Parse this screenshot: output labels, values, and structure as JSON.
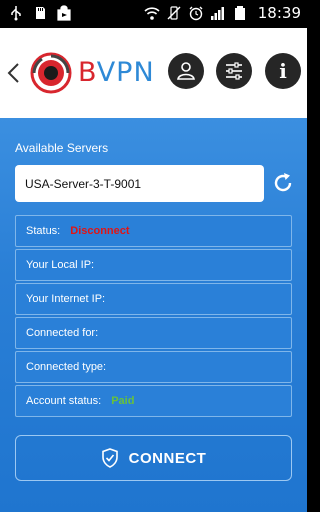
{
  "statusbar": {
    "time": "18:39",
    "left_icons": [
      "usb-icon",
      "sd-card-icon",
      "play-store-icon"
    ],
    "right_icons": [
      "wifi-icon",
      "mute-icon",
      "alarm-icon",
      "signal-icon",
      "battery-icon"
    ]
  },
  "header": {
    "brand_b": "B",
    "brand_rest": "VPN",
    "buttons": [
      "user-icon",
      "settings-sliders-icon",
      "info-icon"
    ],
    "info_letter": "i"
  },
  "servers": {
    "label": "Available Servers",
    "selected": "USA-Server-3-T-9001"
  },
  "info": {
    "status_label": "Status:",
    "status_value": "Disconnect",
    "local_ip_label": "Your Local IP:",
    "internet_ip_label": "Your Internet IP:",
    "connected_for_label": "Connected for:",
    "connected_type_label": "Connected type:",
    "account_status_label": "Account status:",
    "account_status_value": "Paid"
  },
  "actions": {
    "connect_label": "CONNECT"
  },
  "colors": {
    "brand_red": "#d8262e",
    "brand_blue": "#2e89d6",
    "status_red": "#e01515",
    "paid_green": "#68c23a",
    "main_blue": "#2a7fd6"
  }
}
